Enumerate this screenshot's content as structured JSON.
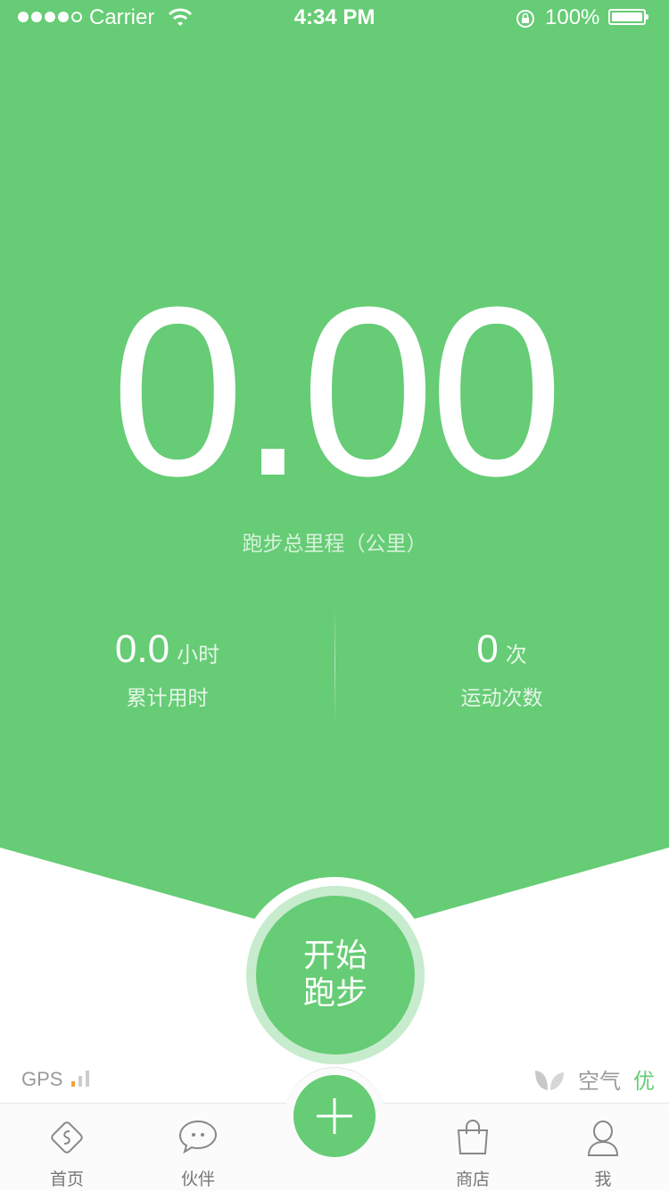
{
  "status_bar": {
    "carrier": "Carrier",
    "time": "4:34 PM",
    "battery": "100%"
  },
  "run_summary": {
    "distance": "0.00",
    "distance_label": "跑步总里程（公里）",
    "duration_value": "0.0",
    "duration_unit": "小时",
    "duration_label": "累计用时",
    "count_value": "0",
    "count_unit": "次",
    "count_label": "运动次数"
  },
  "start_button": {
    "line1": "开始",
    "line2": "跑步"
  },
  "gps": {
    "label": "GPS"
  },
  "air_quality": {
    "label": "空气",
    "value": "优"
  },
  "tabbar": {
    "home": "首页",
    "partner": "伙伴",
    "shop": "商店",
    "me": "我"
  },
  "colors": {
    "accent": "#66cc75",
    "ring": "#c7ebcd",
    "gps_bar_active": "#f0a23a"
  }
}
